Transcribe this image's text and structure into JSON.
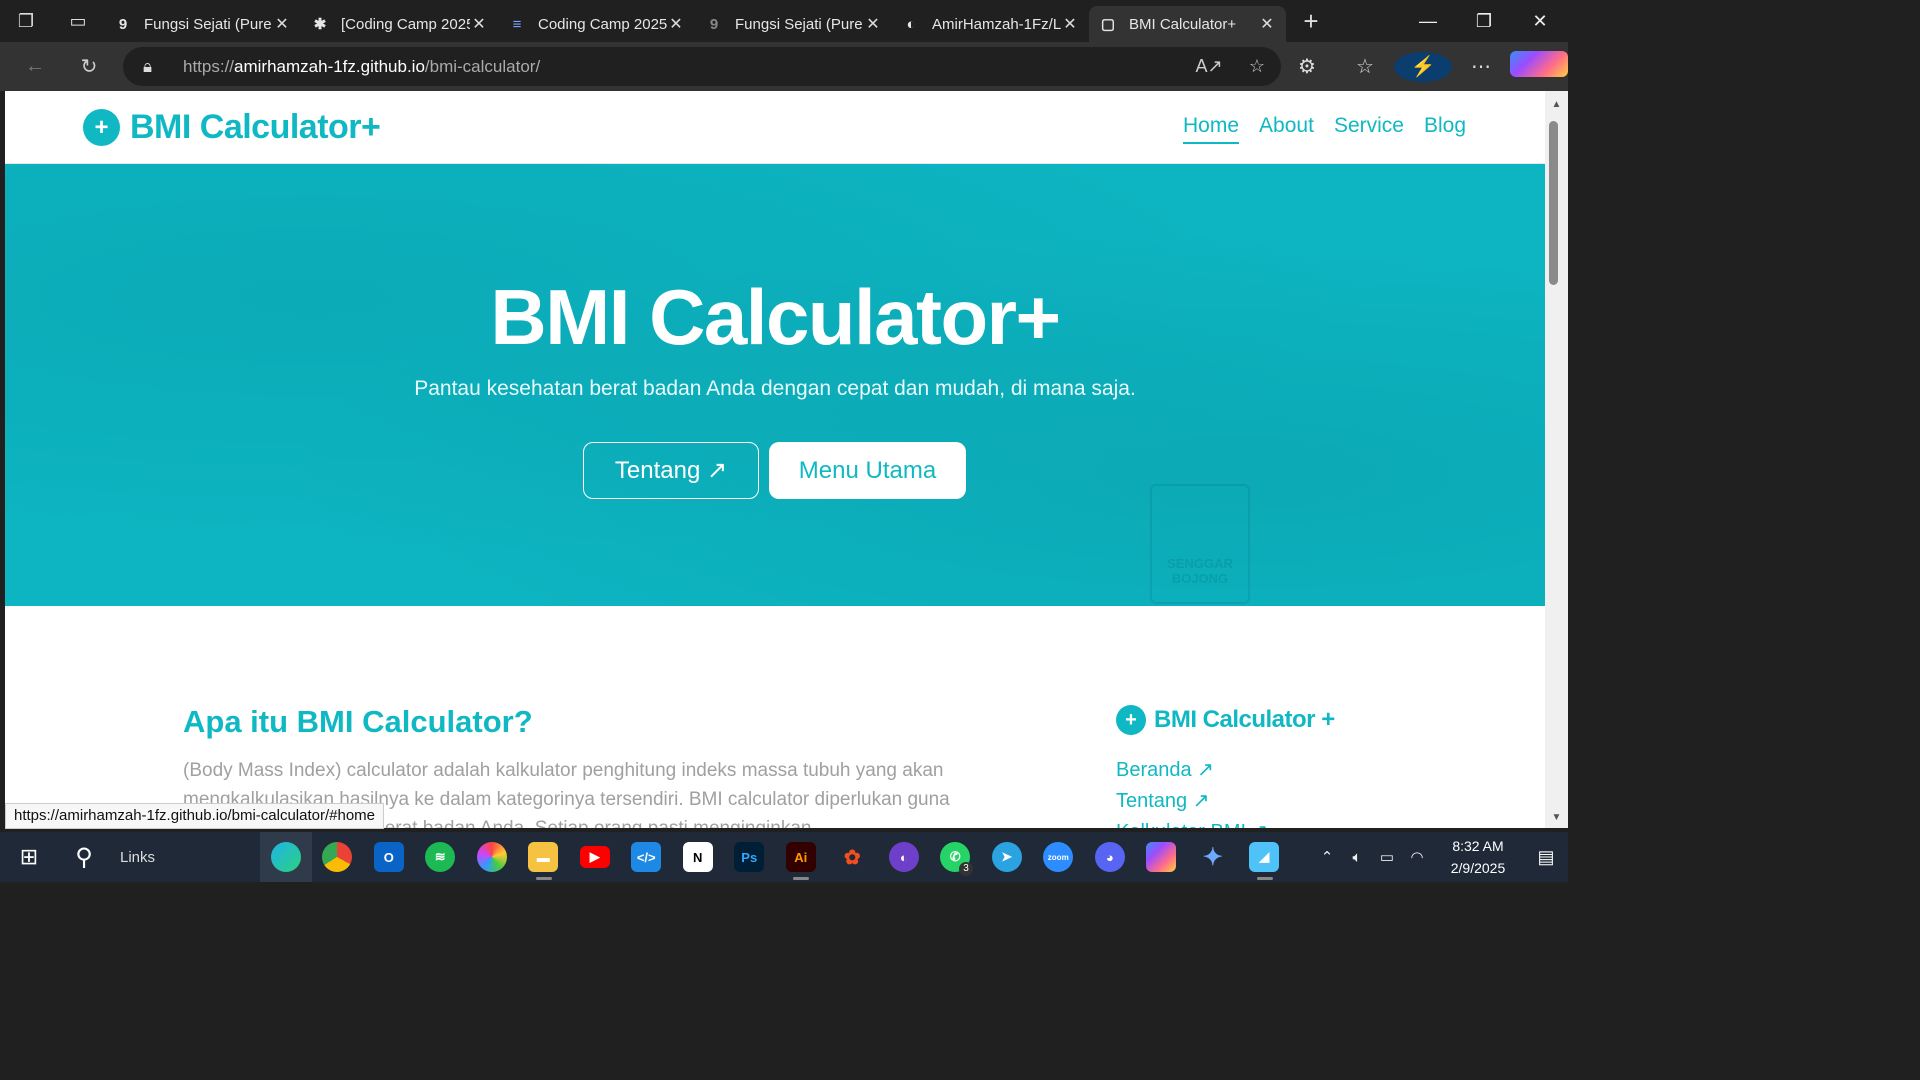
{
  "browser": {
    "tabs": [
      {
        "favicon": "9",
        "title": "Fungsi Sejati (Pure",
        "active": false
      },
      {
        "favicon": "✱",
        "title": "[Coding Camp 2025",
        "active": false
      },
      {
        "favicon": "≡",
        "title": "Coding Camp 2025",
        "active": false
      },
      {
        "favicon": "9",
        "title": "Fungsi Sejati (Pure",
        "active": false
      },
      {
        "favicon": "◐",
        "title": "AmirHamzah-1Fz/L",
        "active": false
      },
      {
        "favicon": "▢",
        "title": "BMI Calculator+",
        "active": true
      }
    ],
    "url_scheme": "https://",
    "url_host": "amirhamzah-1fz.github.io",
    "url_path": "/bmi-calculator/",
    "status_url": "https://amirhamzah-1fz.github.io/bmi-calculator/#home"
  },
  "site": {
    "brand": "BMI Calculator+",
    "nav": [
      {
        "label": "Home",
        "active": true
      },
      {
        "label": "About",
        "active": false
      },
      {
        "label": "Service",
        "active": false
      },
      {
        "label": "Blog",
        "active": false
      }
    ],
    "hero": {
      "title": "BMI Calculator+",
      "subtitle": "Pantau kesehatan berat badan Anda dengan cepat dan mudah, di mana saja.",
      "btn_about": "Tentang ↗",
      "btn_menu": "Menu Utama",
      "sign_text": "SENGGAR BOJONG"
    },
    "section": {
      "heading": "Apa itu BMI Calculator?",
      "paragraph": "(Body Mass Index) calculator adalah kalkulator penghitung indeks massa tubuh yang akan mengkalkulasikan hasilnya ke dalam kategorinya tersendiri. BMI calculator diperlukan guna memeriksa kesehatan berat badan Anda. Setiap orang pasti menginginkan"
    },
    "sidebar": {
      "brand": "BMI Calculator +",
      "links": [
        "Beranda ↗",
        "Tentang ↗",
        "Kalkulator BMI ↗"
      ]
    }
  },
  "taskbar": {
    "search_label": "Links",
    "whatsapp_badge": "3",
    "time": "8:32 AM",
    "date": "2/9/2025"
  },
  "colors": {
    "accent": "#10b8c4",
    "hero_bg": "#0db5c2"
  }
}
